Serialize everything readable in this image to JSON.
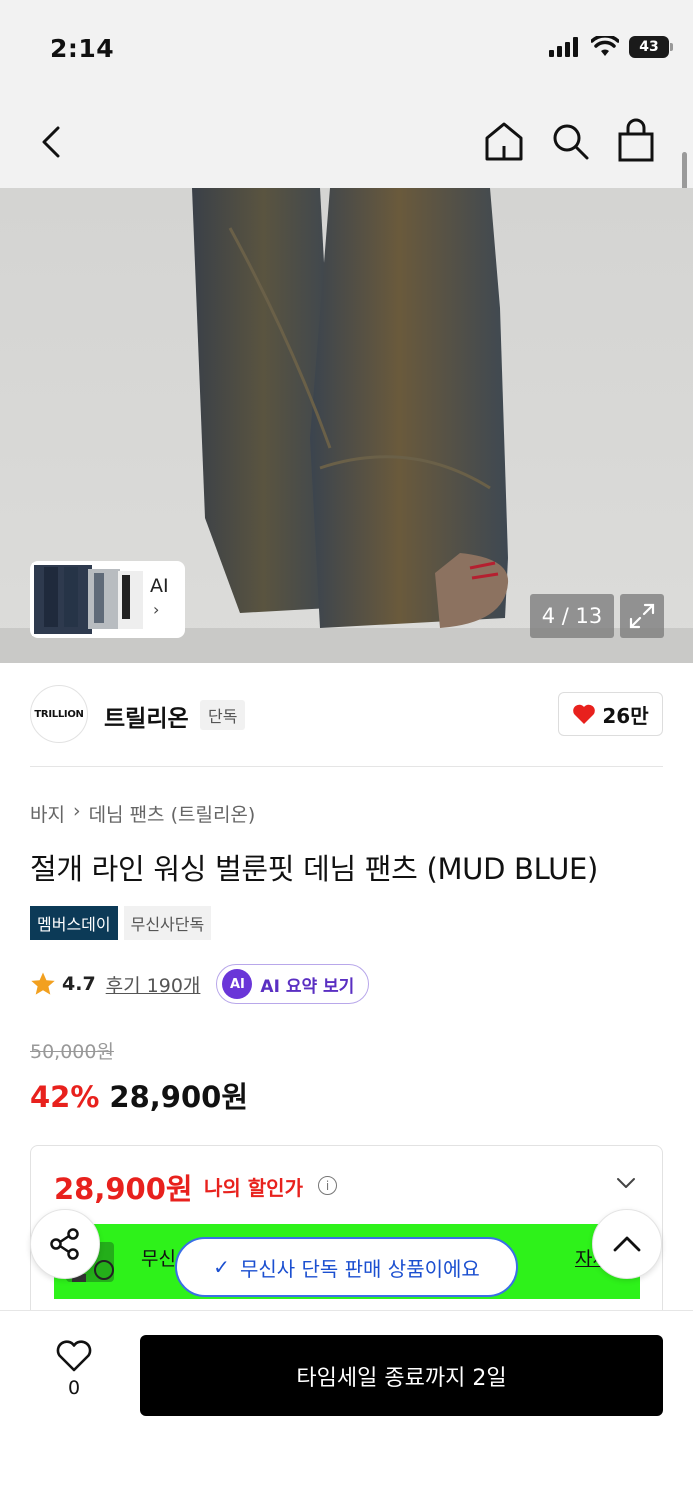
{
  "status_bar": {
    "time": "2:14",
    "battery": "43"
  },
  "nav": {
    "back_icon": "chevron-left-icon",
    "home_icon": "home-icon",
    "search_icon": "search-icon",
    "bag_icon": "shopping-bag-icon"
  },
  "gallery": {
    "thumb_ai_label": "AI",
    "thumb_chevron": "›",
    "counter": "4 / 13",
    "expand_icon": "expand-icon"
  },
  "brand": {
    "logo_text": "TRILLION",
    "name": "트릴리온",
    "badge": "단독",
    "likes": "26만",
    "heart_color": "#e8211d"
  },
  "breadcrumb": [
    "바지",
    "›",
    "데님 팬츠 (트릴리온)"
  ],
  "product": {
    "title": "절개 라인 워싱 벌룬핏 데님 팬츠 (MUD BLUE)",
    "tags": [
      "멤버스데이",
      "무신사단독"
    ],
    "rating": "4.7",
    "review_link": "후기 190개",
    "ai_badge": "AI",
    "ai_summary": "AI 요약 보기",
    "original_price": "50,000원",
    "discount": "42%",
    "sale_price": "28,900원"
  },
  "my_price": {
    "price": "28,900원",
    "label": "나의 할인가",
    "info_icon": "i",
    "banner_text": "무신",
    "banner_link": "자세"
  },
  "toast": {
    "check": "✓",
    "text": "무신사 단독 판매 상품이에요"
  },
  "bottom": {
    "wish_count": "0",
    "buy_label": "타임세일 종료까지 2일"
  },
  "colors": {
    "accent_red": "#e8211d",
    "tag_navy": "#0c3a57",
    "banner_green": "#2ef21a",
    "toast_blue": "#1b4fd0",
    "ai_purple": "#6a36d8"
  }
}
